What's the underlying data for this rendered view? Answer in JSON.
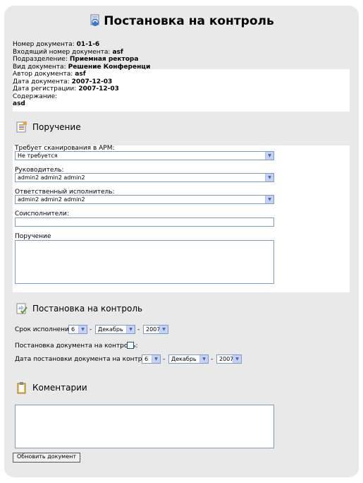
{
  "header": {
    "title": "Постановка на контроль"
  },
  "document_info": [
    {
      "label": "Номер документа:",
      "value": "01-1-6"
    },
    {
      "label": "Входящий номер документа:",
      "value": "asf"
    },
    {
      "label": "Подразделение:",
      "value": "Приемная ректора"
    },
    {
      "label": "Вид документа:",
      "value": "Решение Конференци"
    },
    {
      "label": "Автор документа:",
      "value": "asf"
    },
    {
      "label": "Дата документа:",
      "value": "2007-12-03"
    },
    {
      "label": "Дата регистрации:",
      "value": "2007-12-03"
    },
    {
      "label": "Содержание:",
      "value": ""
    }
  ],
  "content_value": "asd",
  "section_order": {
    "title": "Поручение",
    "scan_label": "Требует сканирования в АРМ:",
    "scan_value": "Не требуется",
    "manager_label": "Руководитель:",
    "manager_value": "admin2 admin2 admin2",
    "executor_label": "Ответственный исполнитель:",
    "executor_value": "admin2 admin2 admin2",
    "coexecutors_label": "Соисполнители:",
    "coexecutors_value": "",
    "order_label": "Поручение",
    "order_value": ""
  },
  "section_control": {
    "title": "Постановка на контроль",
    "deadline_label": "Срок исполнения:",
    "deadline_day": "6",
    "deadline_month": "Декабрь",
    "deadline_year": "2007",
    "dash": "-",
    "put_on_control_label": "Постановка документа на контроль:",
    "put_on_control_checked": false,
    "control_date_label": "Дата постановки документа на контроль:",
    "control_day": "6",
    "control_month": "Декабрь",
    "control_year": "2007"
  },
  "section_comments": {
    "title": "Коментарии",
    "value": ""
  },
  "update_button": "Обновить документ",
  "icons": {
    "title_icon": "document-refresh-icon",
    "order_icon": "task-list-icon",
    "control_icon": "control-check-icon",
    "comments_icon": "clipboard-icon"
  }
}
